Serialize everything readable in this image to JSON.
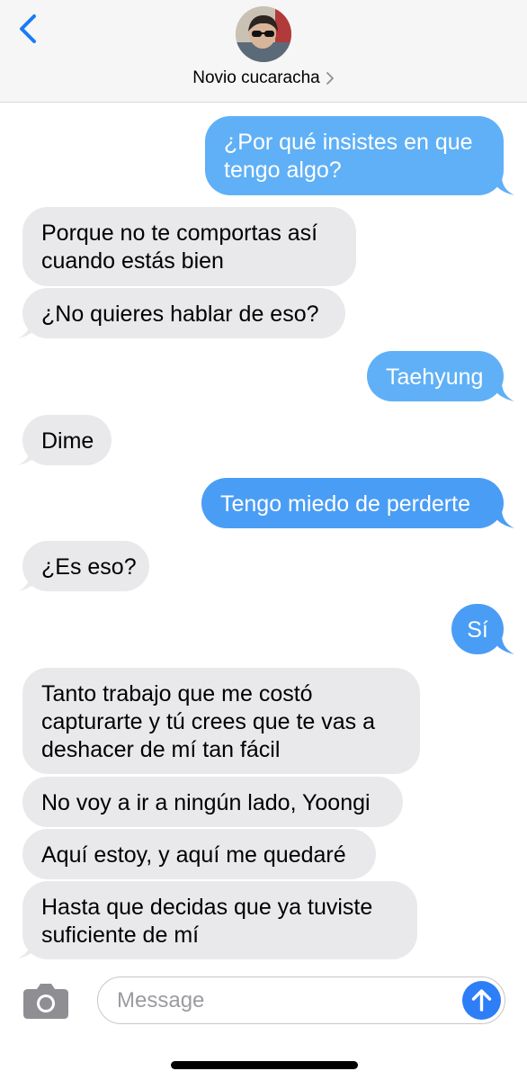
{
  "header": {
    "contact_name": "Novio cucaracha"
  },
  "messages": [
    {
      "side": "sent",
      "text": "¿Por qué insistes en que\ntengo algo?"
    },
    {
      "side": "received",
      "text": "Porque no te comportas así\ncuando estás bien"
    },
    {
      "side": "received",
      "text": "¿No quieres hablar de eso?"
    },
    {
      "side": "sent",
      "text": "Taehyung"
    },
    {
      "side": "received",
      "text": "Dime"
    },
    {
      "side": "sent",
      "text": "Tengo miedo de perderte"
    },
    {
      "side": "received",
      "text": "¿Es eso?"
    },
    {
      "side": "sent",
      "text": "Sí"
    },
    {
      "side": "received",
      "text": "Tanto trabajo que me costó\ncapturarte y tú crees que te vas a\ndeshacer de mí tan fácil"
    },
    {
      "side": "received",
      "text": "No voy a ir a ningún lado, Yoongi"
    },
    {
      "side": "received",
      "text": "Aquí estoy, y aquí me quedaré"
    },
    {
      "side": "received",
      "text": "Hasta que decidas que ya tuviste\nsuficiente de mí"
    }
  ],
  "composer": {
    "placeholder": "Message"
  },
  "icons": {
    "back": "chevron-left-icon",
    "contact_detail": "chevron-right-icon",
    "camera": "camera-icon",
    "send": "arrow-up-icon"
  },
  "colors": {
    "sent_bubble": "#5fb0f6",
    "sent_bubble_deep": "#4a9df5",
    "received_bubble": "#e9e9eb",
    "accent": "#2d7ef7"
  }
}
